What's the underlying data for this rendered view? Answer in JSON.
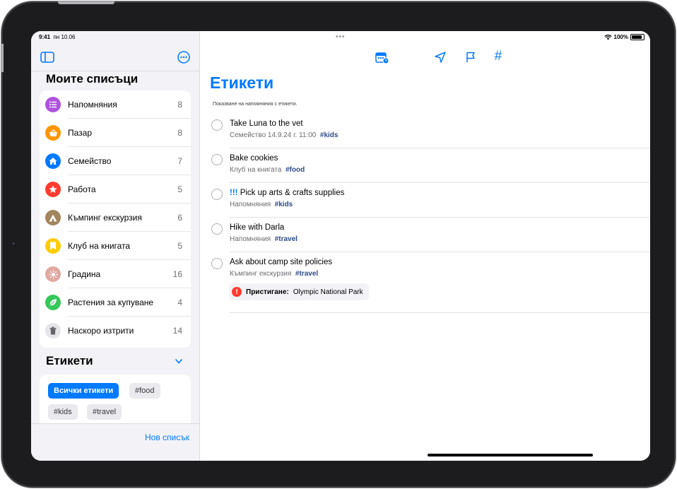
{
  "status": {
    "time": "9:41",
    "date": "пн 10.06",
    "battery": "100%"
  },
  "sidebar": {
    "lists_title": "Моите списъци",
    "lists": [
      {
        "label": "Напомняния",
        "count": "8",
        "color": "#af52de",
        "icon": "list-bullet-icon"
      },
      {
        "label": "Пазар",
        "count": "8",
        "color": "#ff9500",
        "icon": "basket-icon"
      },
      {
        "label": "Семейство",
        "count": "7",
        "color": "#007aff",
        "icon": "house-icon"
      },
      {
        "label": "Работа",
        "count": "5",
        "color": "#ff3b30",
        "icon": "star-icon"
      },
      {
        "label": "Къмпинг екскурзия",
        "count": "6",
        "color": "#a2845e",
        "icon": "tent-icon"
      },
      {
        "label": "Клуб на книгата",
        "count": "5",
        "color": "#ffcc00",
        "icon": "bookmark-icon"
      },
      {
        "label": "Градина",
        "count": "16",
        "color": "#e0a8a0",
        "icon": "sun-icon"
      },
      {
        "label": "Растения за купуване",
        "count": "4",
        "color": "#34c759",
        "icon": "leaf-icon"
      },
      {
        "label": "Наскоро изтрити",
        "count": "14",
        "color": "#e5e5ea",
        "icon": "trash-icon"
      }
    ],
    "tags_title": "Етикети",
    "tags": [
      {
        "label": "Всички етикети",
        "active": true
      },
      {
        "label": "#food",
        "active": false
      },
      {
        "label": "#kids",
        "active": false
      },
      {
        "label": "#travel",
        "active": false
      }
    ],
    "new_list": "Нов списък"
  },
  "main": {
    "title": "Етикети",
    "subtitle": "Показване на напомняния с етикети.",
    "tasks": [
      {
        "priority": "",
        "title": "Take Luna to the vet",
        "meta": "Семейство  14.9.24 г. 11:00",
        "tag": "#kids"
      },
      {
        "priority": "",
        "title": "Bake cookies",
        "meta": "Клуб на книгата",
        "tag": "#food"
      },
      {
        "priority": "!!!",
        "title": "Pick up arts & crafts supplies",
        "meta": "Напомняния",
        "tag": "#kids"
      },
      {
        "priority": "",
        "title": "Hike with Darla",
        "meta": "Напомняния",
        "tag": "#travel"
      },
      {
        "priority": "",
        "title": "Ask about camp site policies",
        "meta": "Къмпинг екскурзия",
        "tag": "#travel",
        "location_label": "Пристигане:",
        "location": "Olympic National Park"
      }
    ]
  },
  "colors": {
    "accent": "#007aff",
    "tag_text": "#2c4a87"
  }
}
